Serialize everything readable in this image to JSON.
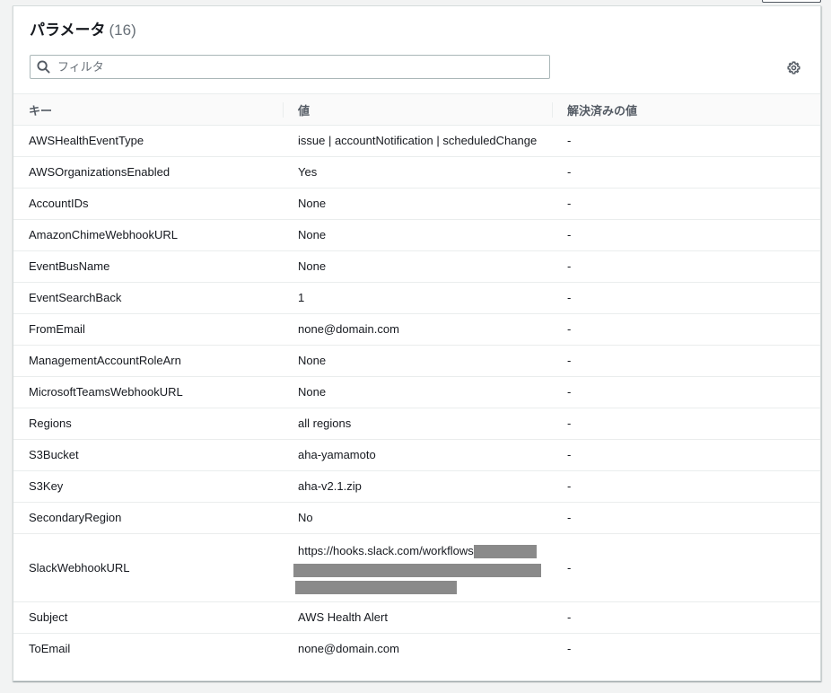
{
  "header": {
    "title": "パラメータ",
    "count": "(16)"
  },
  "filter": {
    "placeholder": "フィルタ"
  },
  "columns": {
    "key": "キー",
    "value": "値",
    "resolved": "解決済みの値"
  },
  "rows": [
    {
      "key": "AWSHealthEventType",
      "value": "issue | accountNotification | scheduledChange",
      "resolved": "-"
    },
    {
      "key": "AWSOrganizationsEnabled",
      "value": "Yes",
      "resolved": "-"
    },
    {
      "key": "AccountIDs",
      "value": "None",
      "resolved": "-"
    },
    {
      "key": "AmazonChimeWebhookURL",
      "value": "None",
      "resolved": "-"
    },
    {
      "key": "EventBusName",
      "value": "None",
      "resolved": "-"
    },
    {
      "key": "EventSearchBack",
      "value": "1",
      "resolved": "-"
    },
    {
      "key": "FromEmail",
      "value": "none@domain.com",
      "resolved": "-"
    },
    {
      "key": "ManagementAccountRoleArn",
      "value": "None",
      "resolved": "-"
    },
    {
      "key": "MicrosoftTeamsWebhookURL",
      "value": "None",
      "resolved": "-"
    },
    {
      "key": "Regions",
      "value": "all regions",
      "resolved": "-"
    },
    {
      "key": "S3Bucket",
      "value": "aha-yamamoto",
      "resolved": "-"
    },
    {
      "key": "S3Key",
      "value": "aha-v2.1.zip",
      "resolved": "-"
    },
    {
      "key": "SecondaryRegion",
      "value": "No",
      "resolved": "-"
    },
    {
      "key": "SlackWebhookURL",
      "value": "https://hooks.slack.com/workflows",
      "resolved": "-"
    },
    {
      "key": "Subject",
      "value": "AWS Health Alert",
      "resolved": "-"
    },
    {
      "key": "ToEmail",
      "value": "none@domain.com",
      "resolved": "-"
    }
  ],
  "icons": {
    "search": "search-icon",
    "settings": "gear-icon"
  },
  "colors": {
    "header_text": "#545b64",
    "border": "#eaeded",
    "redaction": "#8a8a8a"
  }
}
